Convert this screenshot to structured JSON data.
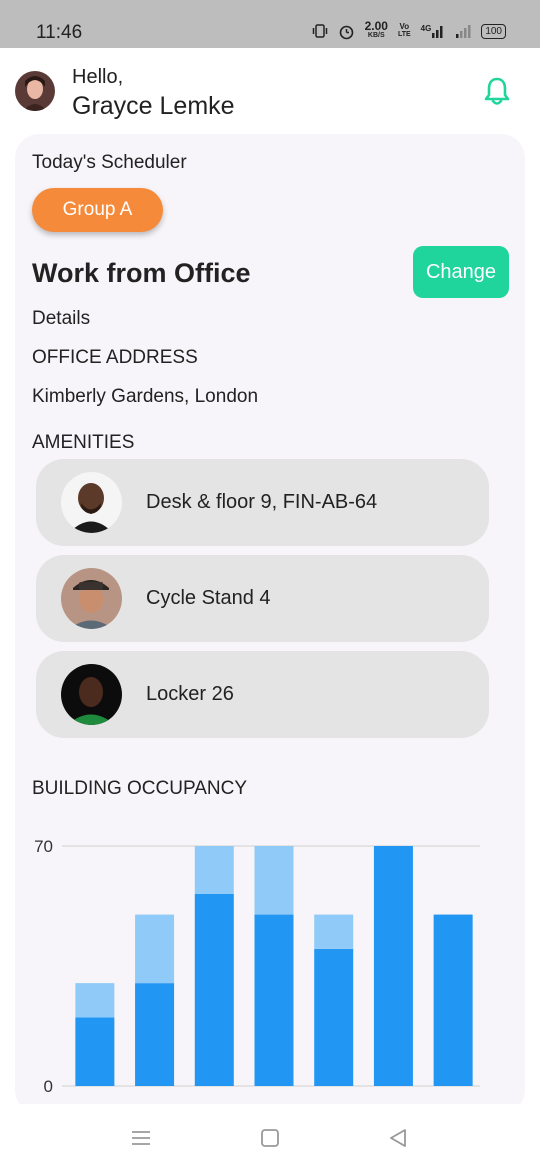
{
  "status": {
    "time": "11:46",
    "speed": "2.00",
    "speed_unit": "KB/S",
    "volte_top": "Vo",
    "volte_bottom": "LTE",
    "network": "4G",
    "battery": "100"
  },
  "header": {
    "greeting": "Hello,",
    "user_name": "Grayce Lemke"
  },
  "scheduler": {
    "title": "Today's Scheduler",
    "group": "Group A",
    "mode": "Work from Office",
    "change_label": "Change",
    "details_label": "Details",
    "address_label": "OFFICE ADDRESS",
    "address_value": "Kimberly Gardens, London",
    "amenities_label": "AMENITIES",
    "amenities": [
      {
        "label": "Desk & floor 9, FIN-AB-64",
        "icon": "avatar-photo"
      },
      {
        "label": "Cycle Stand 4",
        "icon": "avatar-photo"
      },
      {
        "label": "Locker 26",
        "icon": "avatar-photo"
      }
    ]
  },
  "occupancy": {
    "label": "BUILDING OCCUPANCY"
  },
  "chart_data": {
    "type": "bar",
    "stacked": true,
    "categories": [
      "",
      "",
      "",
      "",
      "",
      "",
      ""
    ],
    "series": [
      {
        "values": [
          20,
          30,
          56,
          50,
          40,
          70,
          50
        ],
        "color": "#2196f3"
      },
      {
        "values": [
          10,
          20,
          14,
          20,
          10,
          0,
          0
        ],
        "color": "#90caf9"
      }
    ],
    "y_ticks": [
      0,
      70
    ],
    "ylim": [
      0,
      70
    ],
    "grid": true
  },
  "colors": {
    "accent": "#1fd59b",
    "group_pill": "#f58a3a",
    "bar_dark": "#2196f3",
    "bar_light": "#90caf9"
  },
  "nav": {
    "menu_icon": "menu-icon",
    "home_icon": "home-icon",
    "back_icon": "back-icon"
  }
}
